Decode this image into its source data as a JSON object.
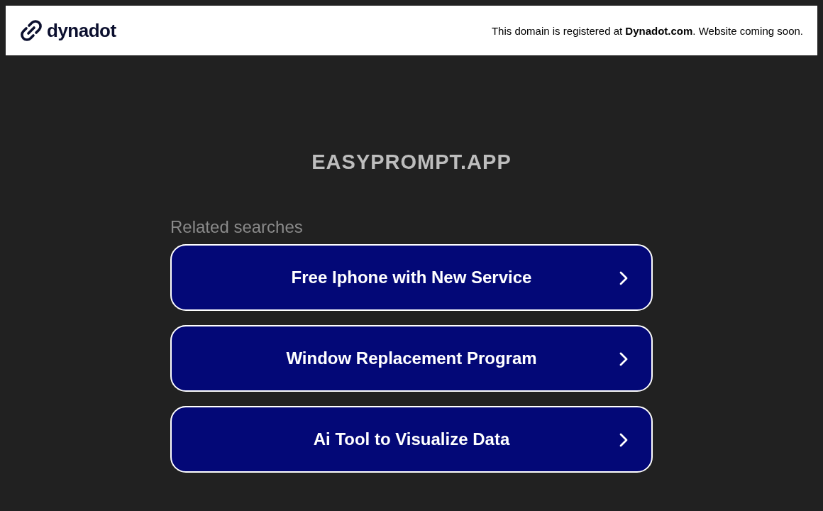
{
  "header": {
    "logo_text": "dynadot",
    "notice": "This domain is registered at **Dynadot.com**. Website coming soon."
  },
  "domain": "EASYPROMPT.APP",
  "related_label": "Related searches",
  "searches": [
    {
      "label": "Free Iphone with New Service"
    },
    {
      "label": "Window Replacement Program"
    },
    {
      "label": "Ai Tool to Visualize Data"
    }
  ]
}
